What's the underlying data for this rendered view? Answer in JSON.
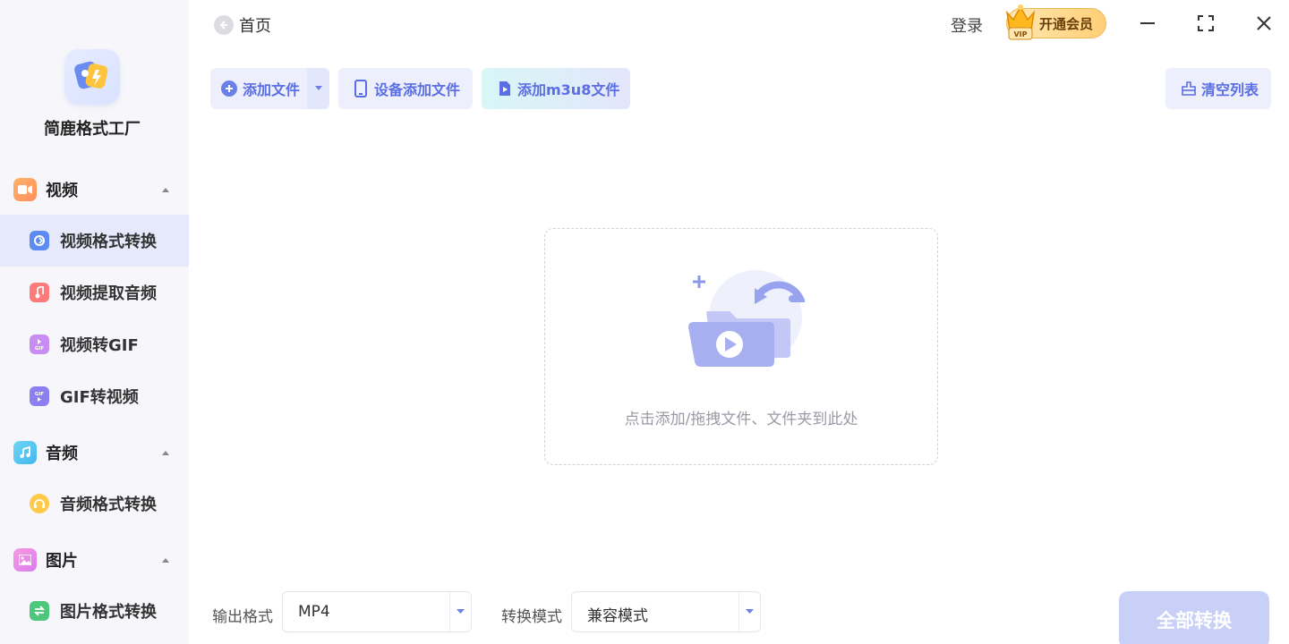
{
  "app": {
    "name": "简鹿格式工厂"
  },
  "header": {
    "home_label": "首页",
    "login_label": "登录",
    "vip_label": "开通会员",
    "vip_badge": "VIP"
  },
  "sidebar": {
    "groups": [
      {
        "label": "视频",
        "items": [
          {
            "label": "视频格式转换",
            "active": true
          },
          {
            "label": "视频提取音频"
          },
          {
            "label": "视频转GIF"
          },
          {
            "label": "GIF转视频"
          }
        ]
      },
      {
        "label": "音频",
        "items": [
          {
            "label": "音频格式转换"
          }
        ]
      },
      {
        "label": "图片",
        "items": [
          {
            "label": "图片格式转换"
          }
        ]
      }
    ]
  },
  "toolbar": {
    "add_file": "添加文件",
    "device_add": "设备添加文件",
    "add_m3u8": "添加m3u8文件",
    "clear_list": "清空列表"
  },
  "dropzone": {
    "hint": "点击添加/拖拽文件、文件夹到此处"
  },
  "bottom": {
    "output_format_label": "输出格式",
    "output_format_value": "MP4",
    "mode_label": "转换模式",
    "mode_value": "兼容模式",
    "convert_all": "全部转换"
  },
  "colors": {
    "accent": "#5b6ee5",
    "active_bg": "#e6e9fb",
    "vip": "#ffcf78"
  }
}
